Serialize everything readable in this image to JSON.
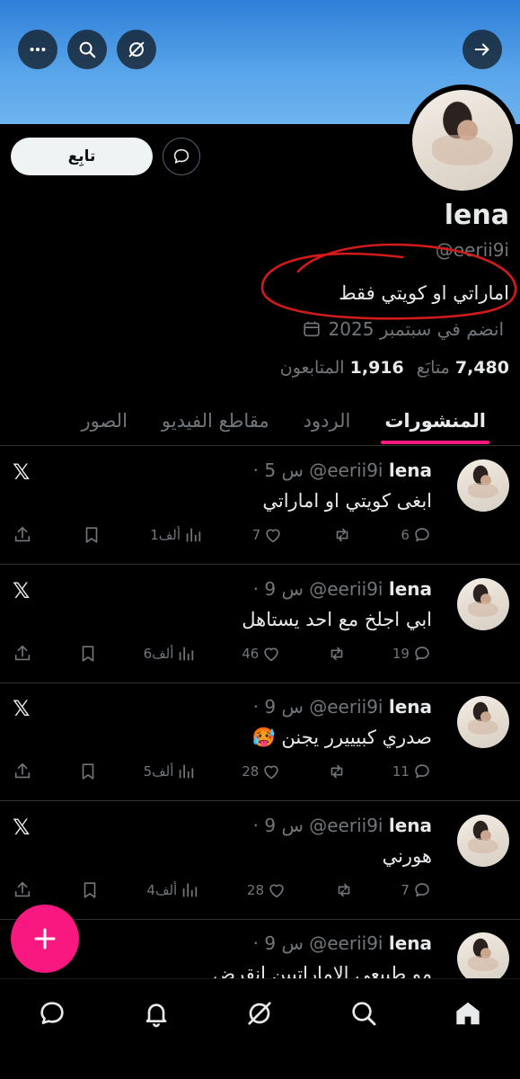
{
  "header": {
    "colors": {
      "banner": "#4a97e2",
      "accent": "#f91880"
    },
    "icons": [
      "more-icon",
      "search-icon",
      "grok-icon",
      "forward-arrow-icon"
    ]
  },
  "profile": {
    "name": "lena",
    "handle": "@eerii9i",
    "bio": "اماراتي او كويتي فقط",
    "joined": "انضم في سبتمبر 2025",
    "following_count": "7,480",
    "following_label": "متابَع",
    "followers_count": "1,916",
    "followers_label": "المتابعون",
    "follow_label": "تابِع"
  },
  "tabs": [
    "المنشورات",
    "الردود",
    "مقاطع الفيديو",
    "الصور"
  ],
  "posts": [
    {
      "name": "lena",
      "handle": "@eerii9i",
      "time": "· 5 س",
      "text": "ابغى كويتي او اماراتي",
      "replies": "6",
      "reposts": "",
      "likes": "7",
      "views": "1ألف"
    },
    {
      "name": "lena",
      "handle": "@eerii9i",
      "time": "· 9 س",
      "text": "ابي اجلخ مع احد يستاهل",
      "replies": "19",
      "reposts": "",
      "likes": "46",
      "views": "6ألف"
    },
    {
      "name": "lena",
      "handle": "@eerii9i",
      "time": "· 9 س",
      "text": "صدري كبيييرر يجنن 🥵",
      "replies": "11",
      "reposts": "",
      "likes": "28",
      "views": "5ألف"
    },
    {
      "name": "lena",
      "handle": "@eerii9i",
      "time": "· 9 س",
      "text": "هورني",
      "replies": "7",
      "reposts": "",
      "likes": "28",
      "views": "4ألف"
    },
    {
      "name": "lena",
      "handle": "@eerii9i",
      "time": "· 9 س",
      "text": "مو طبيعي الاماراتيين انقرض",
      "replies": "",
      "reposts": "",
      "likes": "",
      "views": ""
    }
  ],
  "nav": [
    "home-icon",
    "search-icon",
    "grok-icon",
    "notifications-icon",
    "messages-icon"
  ]
}
